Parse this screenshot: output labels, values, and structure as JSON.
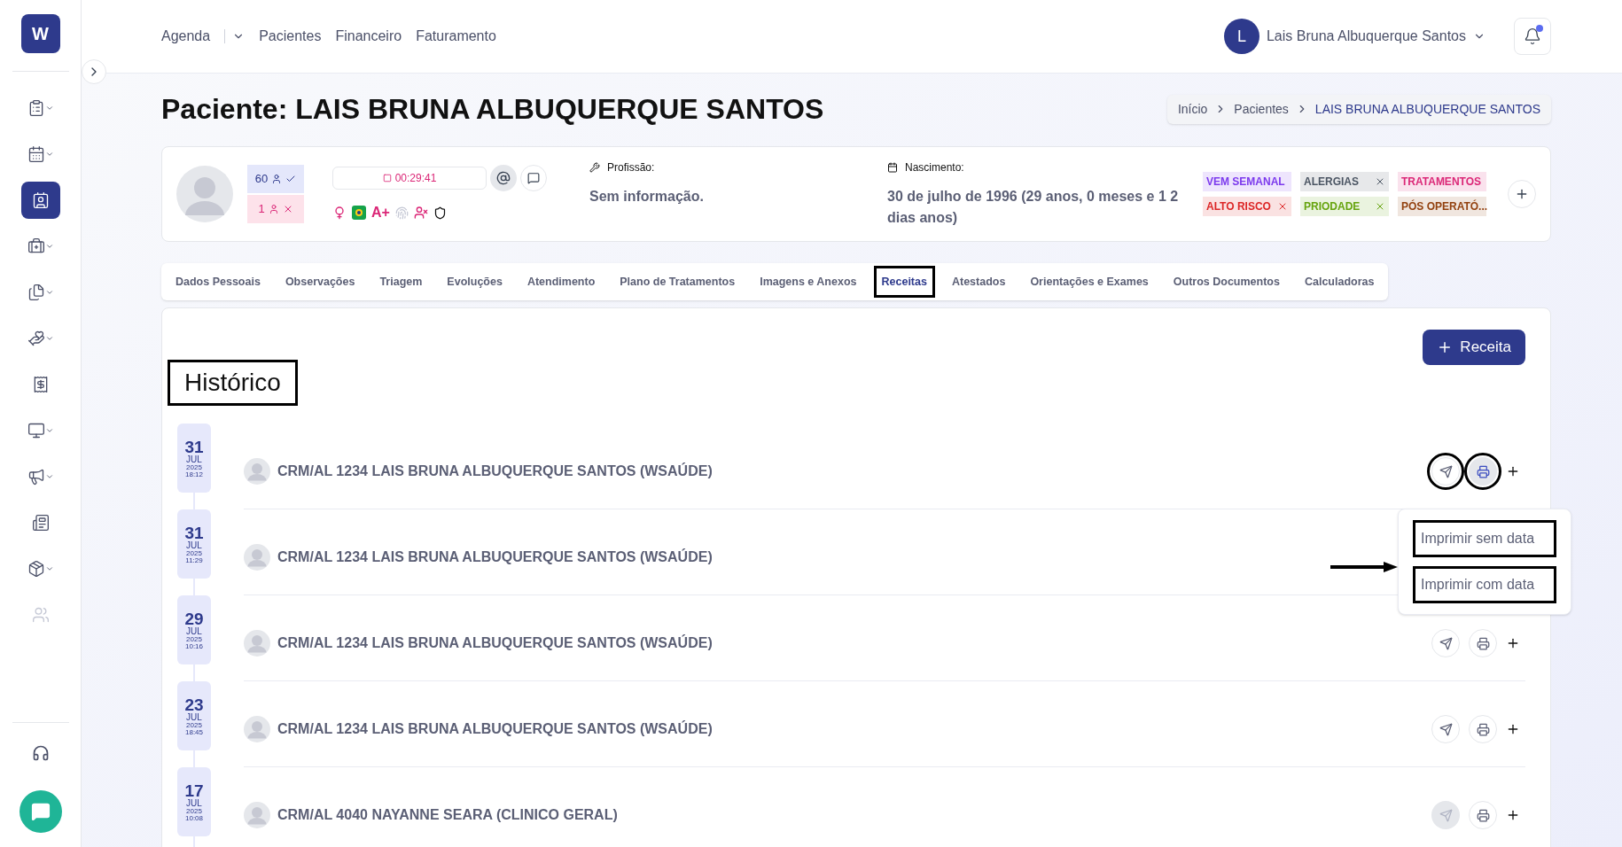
{
  "sidebar": {
    "logo": "W",
    "items": [
      {
        "chevron": true,
        "selected": false,
        "disabled": false
      },
      {
        "chevron": true,
        "selected": false,
        "disabled": false
      },
      {
        "chevron": false,
        "selected": true,
        "disabled": false
      },
      {
        "chevron": true,
        "selected": false,
        "disabled": false
      },
      {
        "chevron": true,
        "selected": false,
        "disabled": false
      },
      {
        "chevron": true,
        "selected": false,
        "disabled": false
      },
      {
        "chevron": false,
        "selected": false,
        "disabled": false
      },
      {
        "chevron": true,
        "selected": false,
        "disabled": false
      },
      {
        "chevron": true,
        "selected": false,
        "disabled": false
      },
      {
        "chevron": false,
        "selected": false,
        "disabled": false
      },
      {
        "chevron": true,
        "selected": false,
        "disabled": false
      },
      {
        "chevron": false,
        "selected": false,
        "disabled": true
      }
    ]
  },
  "nav": [
    "Agenda",
    "Pacientes",
    "Financeiro",
    "Faturamento"
  ],
  "user": {
    "initial": "L",
    "name": "Lais Bruna Albuquerque Santos",
    "notification": true
  },
  "title": "Paciente: LAIS BRUNA ALBUQUERQUE SANTOS",
  "breadcrumb": [
    "Início",
    "Pacientes",
    "LAIS BRUNA ALBUQUERQUE SANTOS"
  ],
  "patient": {
    "counts": [
      {
        "value": "60",
        "kind": "ok"
      },
      {
        "value": "1",
        "kind": "cancel"
      }
    ],
    "timer": "00:29:41",
    "blood_type": "A+",
    "profession": {
      "label": "Profissão:",
      "value": "Sem informação."
    },
    "birth": {
      "label": "Nascimento:",
      "value": "30 de julho de 1996 (29 anos, 0 meses e 1 2 dias anos)"
    },
    "tags": [
      {
        "label": "VEM SEMANAL",
        "color": "#7c3aed"
      },
      {
        "label": "ALERGIAS",
        "color": "#4b5563"
      },
      {
        "label": "TRATAMENTOS",
        "color": "#db2777"
      },
      {
        "label": "ALTO RISCO",
        "color": "#dc2626"
      },
      {
        "label": "PRIODADE",
        "color": "#65a30d"
      },
      {
        "label": "PÓS OPERATÓ...",
        "color": "#92400e"
      }
    ]
  },
  "tabs": [
    {
      "label": "Dados Pessoais",
      "selected": false
    },
    {
      "label": "Observações",
      "selected": false
    },
    {
      "label": "Triagem",
      "selected": false
    },
    {
      "label": "Evoluções",
      "selected": false
    },
    {
      "label": "Atendimento",
      "selected": false
    },
    {
      "label": "Plano de Tratamentos",
      "selected": false
    },
    {
      "label": "Imagens e Anexos",
      "selected": false
    },
    {
      "label": "Receitas",
      "selected": true
    },
    {
      "label": "Atestados",
      "selected": false
    },
    {
      "label": "Orientações e Exames",
      "selected": false
    },
    {
      "label": "Outros Documentos",
      "selected": false
    },
    {
      "label": "Calculadoras",
      "selected": false
    }
  ],
  "new_button": "Receita",
  "section_title": "Histórico",
  "entries": [
    {
      "day": "31",
      "month": "JUL",
      "year": "2025",
      "time": "18:12",
      "author": "CRM/AL 1234 LAIS BRUNA ALBUQUERQUE SANTOS (WSAÚDE)",
      "send_disabled": false,
      "print_active": true
    },
    {
      "day": "31",
      "month": "JUL",
      "year": "2025",
      "time": "11:29",
      "author": "CRM/AL 1234 LAIS BRUNA ALBUQUERQUE SANTOS (WSAÚDE)"
    },
    {
      "day": "29",
      "month": "JUL",
      "year": "2025",
      "time": "10:16",
      "author": "CRM/AL 1234 LAIS BRUNA ALBUQUERQUE SANTOS (WSAÚDE)",
      "send_disabled": false,
      "print_active": false
    },
    {
      "day": "23",
      "month": "JUL",
      "year": "2025",
      "time": "18:45",
      "author": "CRM/AL 1234 LAIS BRUNA ALBUQUERQUE SANTOS (WSAÚDE)",
      "send_disabled": false,
      "print_active": false
    },
    {
      "day": "17",
      "month": "JUL",
      "year": "2025",
      "time": "10:08",
      "author": "CRM/AL 4040 NAYANNE SEARA (CLINICO GERAL)",
      "send_disabled": true,
      "print_active": false
    }
  ],
  "print_menu": [
    "Imprimir sem data",
    "Imprimir com data"
  ]
}
